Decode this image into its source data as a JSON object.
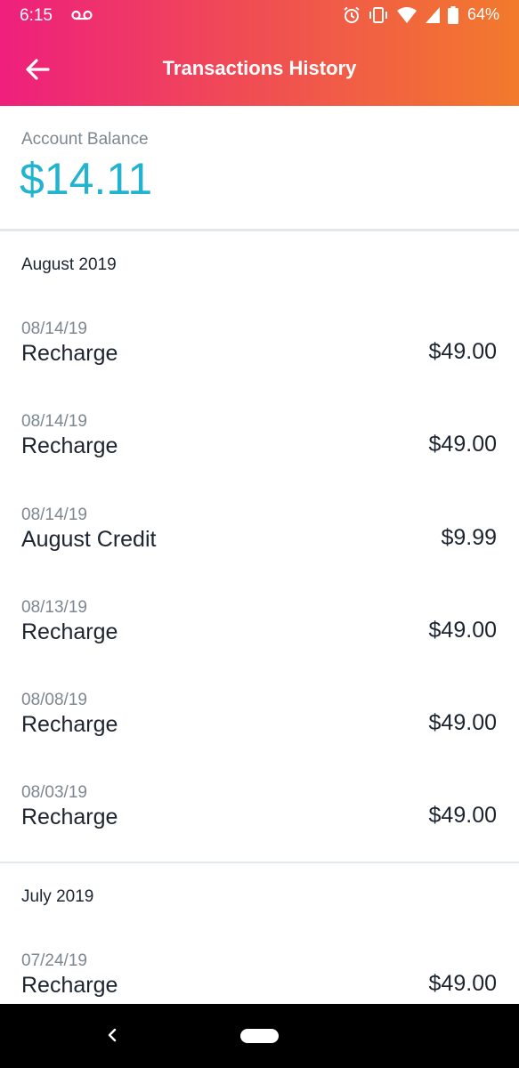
{
  "status": {
    "time": "6:15",
    "battery": "64%"
  },
  "header": {
    "title": "Transactions History",
    "back_icon": "arrow-left-icon"
  },
  "balance": {
    "label": "Account Balance",
    "value": "$14.11"
  },
  "colors": {
    "accent": "#21b3cf",
    "gradient_start": "#ee1f7d",
    "gradient_end": "#f27a2c"
  },
  "sections": [
    {
      "title": "August 2019",
      "transactions": [
        {
          "date": "08/14/19",
          "description": "Recharge",
          "amount": "$49.00"
        },
        {
          "date": "08/14/19",
          "description": "Recharge",
          "amount": "$49.00"
        },
        {
          "date": "08/14/19",
          "description": "August Credit",
          "amount": "$9.99"
        },
        {
          "date": "08/13/19",
          "description": "Recharge",
          "amount": "$49.00"
        },
        {
          "date": "08/08/19",
          "description": "Recharge",
          "amount": "$49.00"
        },
        {
          "date": "08/03/19",
          "description": "Recharge",
          "amount": "$49.00"
        }
      ]
    },
    {
      "title": "July 2019",
      "transactions": [
        {
          "date": "07/24/19",
          "description": "Recharge",
          "amount": "$49.00"
        }
      ]
    }
  ]
}
